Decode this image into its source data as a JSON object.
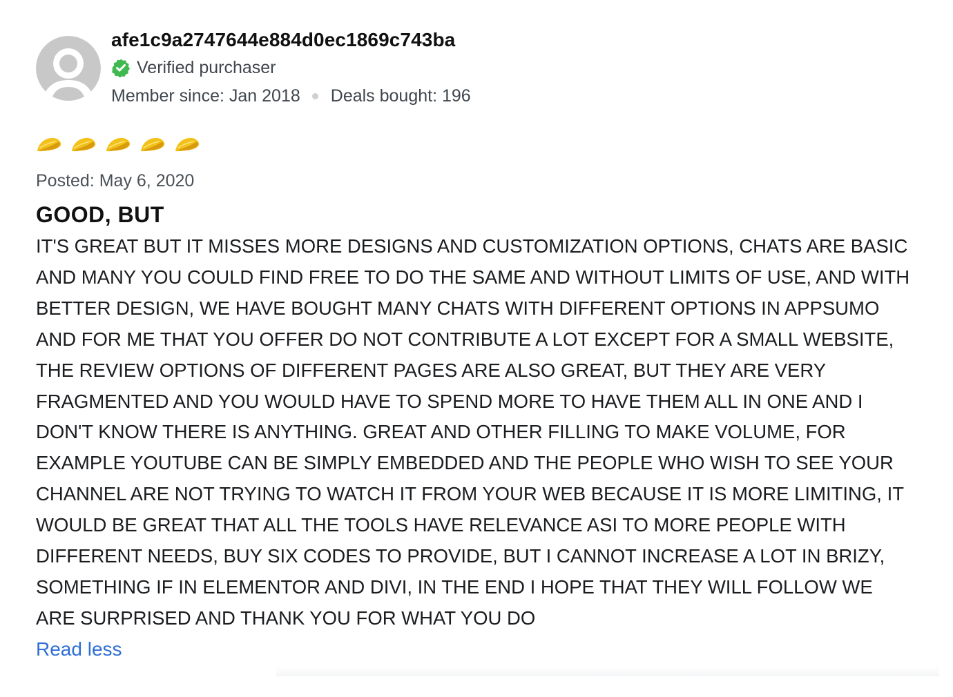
{
  "review": {
    "username": "afe1c9a2747644e884d0ec1869c743ba",
    "verified_label": "Verified purchaser",
    "member_since": "Member since: Jan 2018",
    "deals_bought": "Deals bought: 196",
    "rating": 5,
    "rating_icon": "taco-icon",
    "posted": "Posted: May 6, 2020",
    "title": "GOOD, BUT",
    "body_lines": [
      "IT'S GREAT BUT IT MISSES MORE DESIGNS AND CUSTOMIZATION OPTIONS, CHATS ARE BASIC",
      "AND MANY YOU COULD FIND FREE TO DO THE SAME AND WITHOUT LIMITS OF USE, AND WITH",
      "BETTER DESIGN, WE HAVE BOUGHT MANY CHATS WITH DIFFERENT OPTIONS IN APPSUMO",
      "AND FOR ME THAT YOU OFFER DO NOT CONTRIBUTE A LOT EXCEPT FOR A SMALL WEBSITE,",
      "THE REVIEW OPTIONS OF DIFFERENT PAGES ARE ALSO GREAT, BUT THEY ARE VERY",
      "FRAGMENTED AND YOU WOULD HAVE TO SPEND MORE TO HAVE THEM ALL IN ONE AND I",
      "DON'T KNOW THERE IS ANYTHING. GREAT AND OTHER FILLING TO MAKE VOLUME, FOR",
      "EXAMPLE YOUTUBE CAN BE SIMPLY EMBEDDED AND THE PEOPLE WHO WISH TO SEE YOUR",
      "CHANNEL ARE NOT TRYING TO WATCH IT FROM YOUR WEB BECAUSE IT IS MORE LIMITING, IT",
      "WOULD BE GREAT THAT ALL THE TOOLS HAVE RELEVANCE ASI TO MORE PEOPLE WITH",
      "DIFFERENT NEEDS, BUY SIX CODES TO PROVIDE, BUT I CANNOT INCREASE A LOT IN BRIZY,",
      "SOMETHING IF IN ELEMENTOR AND DIVI, IN THE END I HOPE THAT THEY WILL FOLLOW WE",
      "ARE SURPRISED AND THANK YOU FOR WHAT YOU DO"
    ],
    "read_less": "Read less"
  },
  "colors": {
    "verified_green": "#3fb950",
    "link_blue": "#2f6fd6",
    "taco_yellow": "#f2c21a",
    "avatar_gray": "#c8c8c8"
  }
}
